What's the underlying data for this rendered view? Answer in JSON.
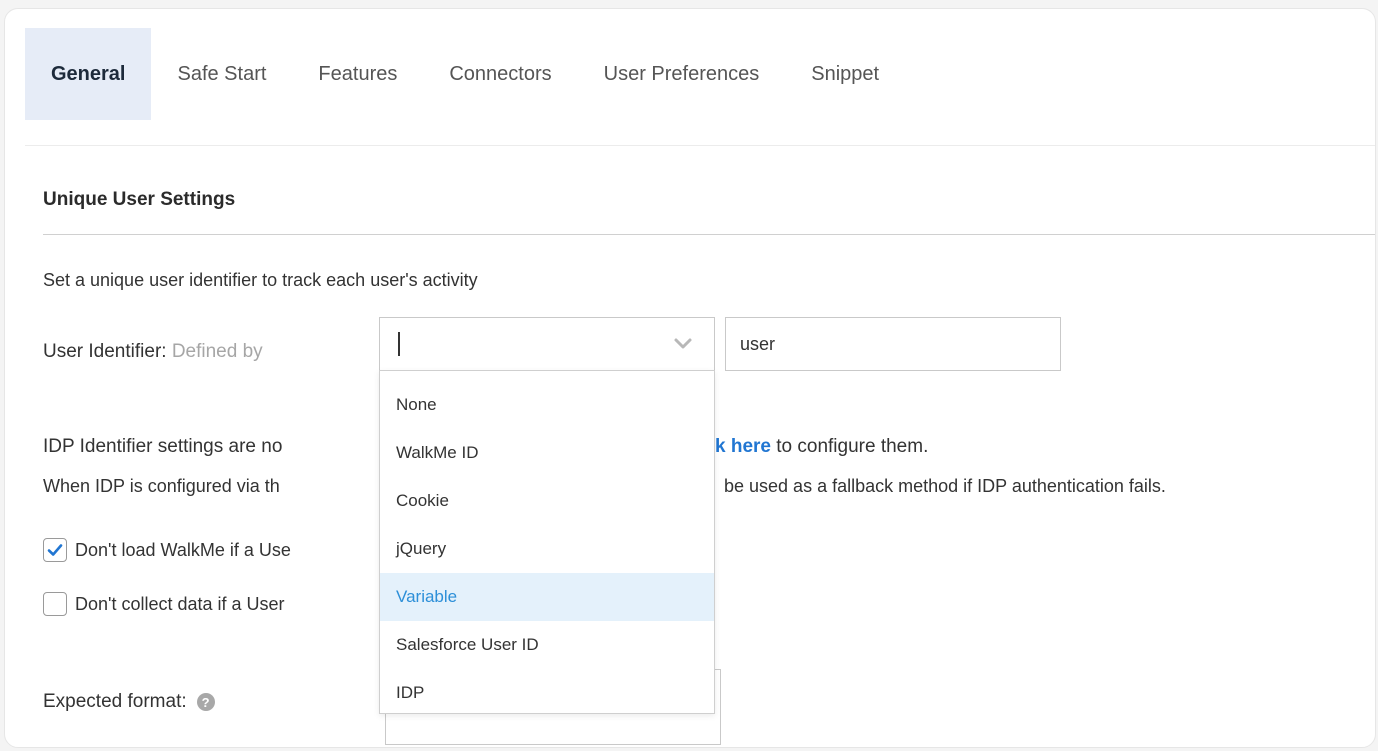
{
  "tabs": [
    {
      "label": "General",
      "active": true
    },
    {
      "label": "Safe Start"
    },
    {
      "label": "Features"
    },
    {
      "label": "Connectors"
    },
    {
      "label": "User Preferences"
    },
    {
      "label": "Snippet"
    }
  ],
  "section": {
    "title": "Unique User Settings",
    "description": "Set a unique user identifier to track each user's activity"
  },
  "user_identifier": {
    "label": "User Identifier:",
    "defined_by": "Defined by",
    "select_value": "",
    "text_value": "user",
    "chevron_icon": "chevron-down-icon"
  },
  "dropdown": {
    "options": [
      "None",
      "WalkMe ID",
      "Cookie",
      "jQuery",
      "Variable",
      "Salesforce User ID",
      "IDP"
    ],
    "highlighted": "Variable",
    "highlight_color": "#2c8fd8"
  },
  "idp": {
    "line1_visible_start": "IDP Identifier settings are no",
    "line1_link": "k here",
    "line1_end": " to configure them.",
    "line2_visible_start": "When IDP is configured via th",
    "line2_end": "be used as a fallback method if IDP authentication fails."
  },
  "checkboxes": [
    {
      "label": "Don't load WalkMe if a Use",
      "checked": true
    },
    {
      "label": "Don't collect data if a User",
      "checked": false
    }
  ],
  "expected_format": {
    "label": "Expected format:",
    "help_icon": "question-icon"
  },
  "colors": {
    "accent": "#2176d2",
    "active_tab_bg": "#e6ecf7",
    "highlight_bg": "#e4f1fb"
  }
}
